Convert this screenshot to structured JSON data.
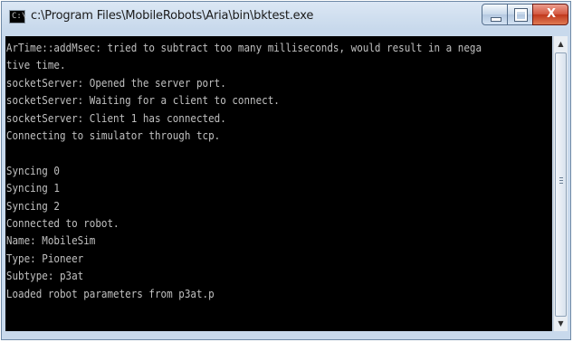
{
  "window": {
    "title": "c:\\Program Files\\MobileRobots\\Aria\\bin\\bktest.exe",
    "controls": {
      "minimize": "‒",
      "maximize": "□",
      "close": "X"
    }
  },
  "console": {
    "text": "ArTime::addMsec: tried to subtract too many milliseconds, would result in a nega\ntive time.\nsocketServer: Opened the server port.\nsocketServer: Waiting for a client to connect.\nsocketServer: Client 1 has connected.\nConnecting to simulator through tcp.\n\nSyncing 0\nSyncing 1\nSyncing 2\nConnected to robot.\nName: MobileSim\nType: Pioneer\nSubtype: p3at\nLoaded robot parameters from p3at.p"
  },
  "scrollbar": {
    "up_arrow": "▲",
    "down_arrow": "▼"
  },
  "colors": {
    "console_bg": "#000000",
    "console_fg": "#c0c0c0",
    "close_button": "#c1381d"
  }
}
